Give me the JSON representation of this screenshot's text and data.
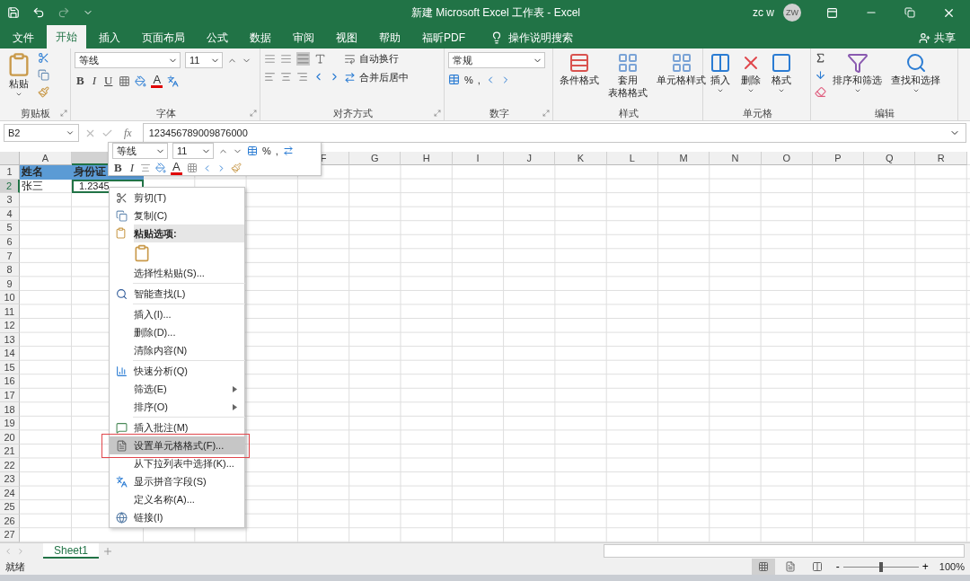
{
  "title_bar": {
    "title": "新建 Microsoft Excel 工作表  -  Excel",
    "user": "zc w",
    "avatar": "ZW"
  },
  "tabs": [
    {
      "label": "文件",
      "selected": false
    },
    {
      "label": "开始",
      "selected": true
    },
    {
      "label": "插入",
      "selected": false
    },
    {
      "label": "页面布局",
      "selected": false
    },
    {
      "label": "公式",
      "selected": false
    },
    {
      "label": "数据",
      "selected": false
    },
    {
      "label": "审阅",
      "selected": false
    },
    {
      "label": "视图",
      "selected": false
    },
    {
      "label": "帮助",
      "selected": false
    },
    {
      "label": "福昕PDF",
      "selected": false
    }
  ],
  "tell_me": "操作说明搜索",
  "share": "共享",
  "ribbon": {
    "clipboard": {
      "paste": "粘贴",
      "label": "剪贴板"
    },
    "font": {
      "font_name": "等线",
      "font_size": "11",
      "bold": "B",
      "italic": "I",
      "underline": "U",
      "font_color": "A",
      "label": "字体"
    },
    "alignment": {
      "wrap": "自动换行",
      "merge": "合并后居中",
      "label": "对齐方式"
    },
    "number": {
      "format": "常规",
      "percent": "%",
      "comma": ",",
      "label": "数字"
    },
    "styles": {
      "buttons": [
        {
          "lines": [
            "条件格式"
          ]
        },
        {
          "lines": [
            "套用",
            "表格格式"
          ]
        },
        {
          "lines": [
            "单元格样式"
          ]
        }
      ],
      "label": "样式"
    },
    "cells": {
      "buttons": [
        "插入",
        "删除",
        "格式"
      ],
      "label": "单元格"
    },
    "editing": {
      "buttons": [
        "排序和筛选",
        "查找和选择"
      ],
      "label": "编辑"
    }
  },
  "formula_bar": {
    "name_box": "B2",
    "fx": "fx",
    "formula": "123456789009876000"
  },
  "sheet": {
    "columns": [
      {
        "label": "A",
        "selected": false
      },
      {
        "selected": true
      },
      {},
      {},
      {},
      {
        "label": "F",
        "selected": false
      },
      {
        "label": "G",
        "selected": false
      },
      {
        "label": "H",
        "selected": false
      },
      {
        "label": "I",
        "selected": false
      },
      {
        "label": "J",
        "selected": false
      },
      {
        "label": "K",
        "selected": false
      },
      {
        "label": "L",
        "selected": false
      },
      {
        "label": "M",
        "selected": false
      },
      {
        "label": "N",
        "selected": false
      },
      {
        "label": "O",
        "selected": false
      },
      {
        "label": "P",
        "selected": false
      },
      {
        "label": "Q",
        "selected": false
      },
      {
        "label": "R",
        "selected": false
      }
    ],
    "rows": [
      {
        "label": "1",
        "selected": false,
        "cells": [
          {
            "text": "姓名",
            "kind": "header",
            "selected": false
          },
          {
            "text": "身份证",
            "kind": "header",
            "selected": false
          }
        ]
      },
      {
        "label": "2",
        "selected": true,
        "cells": [
          {
            "text": "张三",
            "kind": "text",
            "selected": false
          },
          {
            "text": "1.2345",
            "kind": "number",
            "selected": true
          }
        ]
      },
      {
        "label": "3",
        "selected": false
      },
      {
        "label": "4",
        "selected": false
      },
      {
        "label": "5",
        "selected": false
      },
      {
        "label": "6",
        "selected": false
      },
      {
        "label": "7",
        "selected": false
      },
      {
        "label": "8",
        "selected": false
      },
      {
        "label": "9",
        "selected": false
      },
      {
        "label": "10",
        "selected": false
      },
      {
        "label": "11",
        "selected": false
      },
      {
        "label": "12",
        "selected": false
      },
      {
        "label": "13",
        "selected": false
      },
      {
        "label": "14",
        "selected": false
      },
      {
        "label": "15",
        "selected": false
      },
      {
        "label": "16",
        "selected": false
      },
      {
        "label": "17",
        "selected": false
      },
      {
        "label": "18",
        "selected": false
      },
      {
        "label": "19",
        "selected": false
      },
      {
        "label": "20",
        "selected": false
      },
      {
        "label": "21",
        "selected": false
      },
      {
        "label": "22",
        "selected": false
      },
      {
        "label": "23",
        "selected": false
      },
      {
        "label": "24",
        "selected": false
      },
      {
        "label": "25",
        "selected": false
      },
      {
        "label": "26",
        "selected": false
      },
      {
        "label": "27",
        "selected": false
      }
    ]
  },
  "mini_toolbar": {
    "font_name": "等线",
    "font_size": "11",
    "percent": "%",
    "comma": ",",
    "bold": "B",
    "italic": "I",
    "font_color": "A"
  },
  "context_menu": [
    {
      "kind": "item",
      "label": "剪切(T)",
      "selected": false,
      "submenu": false,
      "outlined": false
    },
    {
      "kind": "item",
      "label": "复制(C)",
      "selected": false,
      "submenu": false,
      "outlined": false
    },
    {
      "kind": "header",
      "label": "粘贴选项:"
    },
    {
      "kind": "paste-options"
    },
    {
      "kind": "item",
      "label": "选择性粘贴(S)...",
      "selected": false,
      "submenu": false,
      "outlined": false
    },
    {
      "kind": "separator"
    },
    {
      "kind": "item",
      "label": "智能查找(L)",
      "selected": false,
      "submenu": false,
      "outlined": false
    },
    {
      "kind": "separator"
    },
    {
      "kind": "item",
      "label": "插入(I)...",
      "selected": false,
      "submenu": false,
      "outlined": false
    },
    {
      "kind": "item",
      "label": "删除(D)...",
      "selected": false,
      "submenu": false,
      "outlined": false
    },
    {
      "kind": "item",
      "label": "清除内容(N)",
      "selected": false,
      "submenu": false,
      "outlined": false
    },
    {
      "kind": "separator"
    },
    {
      "kind": "item",
      "label": "快速分析(Q)",
      "selected": false,
      "submenu": false,
      "outlined": false
    },
    {
      "kind": "item",
      "label": "筛选(E)",
      "selected": false,
      "submenu": true,
      "outlined": false
    },
    {
      "kind": "item",
      "label": "排序(O)",
      "selected": false,
      "submenu": true,
      "outlined": false
    },
    {
      "kind": "separator"
    },
    {
      "kind": "item",
      "label": "插入批注(M)",
      "selected": false,
      "submenu": false,
      "outlined": false
    },
    {
      "kind": "item",
      "label": "设置单元格格式(F)...",
      "selected": true,
      "submenu": false,
      "outlined": true
    },
    {
      "kind": "item",
      "label": "从下拉列表中选择(K)...",
      "selected": false,
      "submenu": false,
      "outlined": false
    },
    {
      "kind": "item",
      "label": "显示拼音字段(S)",
      "selected": false,
      "submenu": false,
      "outlined": false
    },
    {
      "kind": "item",
      "label": "定义名称(A)...",
      "selected": false,
      "submenu": false,
      "outlined": false
    },
    {
      "kind": "item",
      "label": "链接(I)",
      "selected": false,
      "submenu": false,
      "outlined": false
    }
  ],
  "sheet_tabs": [
    {
      "label": "Sheet1",
      "selected": true
    }
  ],
  "status_bar": {
    "status": "就绪",
    "views": [
      {
        "selected": true
      },
      {
        "selected": false
      },
      {
        "selected": false
      }
    ],
    "zoom_out": "-",
    "zoom_in": "+",
    "zoom_slider": {
      "level": 0.5
    },
    "zoom": "100%"
  }
}
